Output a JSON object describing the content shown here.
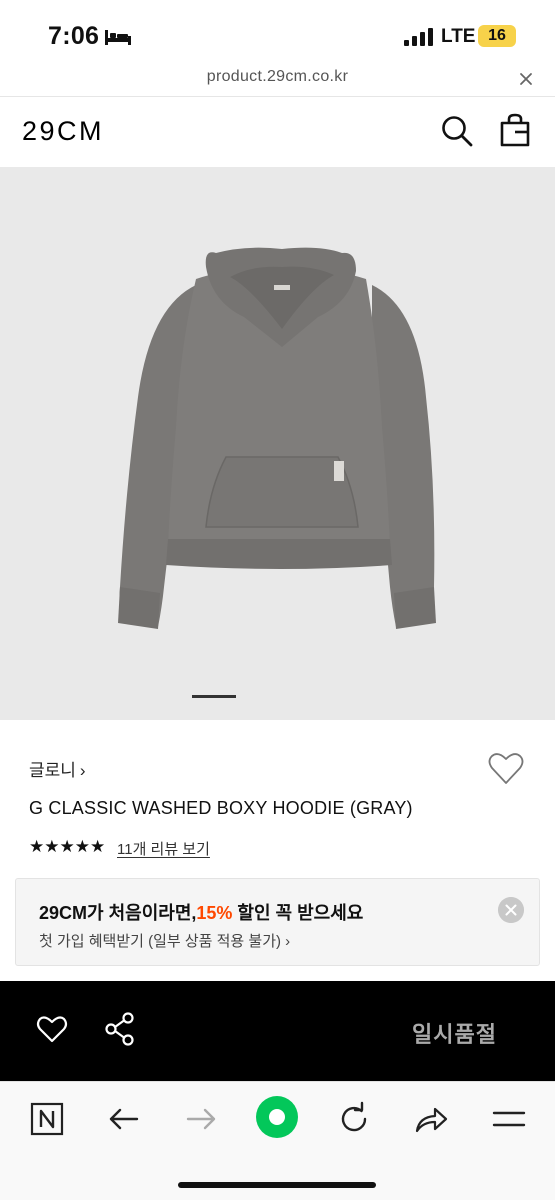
{
  "status_bar": {
    "time": "7:06",
    "network": "LTE",
    "battery": "16"
  },
  "url_bar": {
    "url": "product.29cm.co.kr"
  },
  "header": {
    "logo": "29CM",
    "icons": [
      "search-icon",
      "shopping-bag-icon"
    ]
  },
  "product": {
    "brand": "글로니",
    "name": "G CLASSIC WASHED BOXY HOODIE (GRAY)",
    "rating_stars": "★★★★★",
    "rating": 5,
    "review_link": "11개 리뷰 보기",
    "image_colors": {
      "background": "#e9e9e9",
      "garment": "#7d7b79"
    }
  },
  "promo": {
    "title_prefix": "29CM가 처음이라면,",
    "title_accent": "15%",
    "title_suffix": " 할인 꼭 받으세요",
    "subtitle": "첫 가입 혜택받기 (일부 상품 적용 불가) ›",
    "accent_color": "#ff4800"
  },
  "action_bar": {
    "status_label": "일시품절"
  },
  "browser_toolbar": {
    "icons": [
      "naver-n-icon",
      "back-arrow-icon",
      "forward-arrow-icon",
      "green-home-icon",
      "reload-icon",
      "share-arrow-icon",
      "menu-icon"
    ],
    "green_color": "#03c75a"
  }
}
